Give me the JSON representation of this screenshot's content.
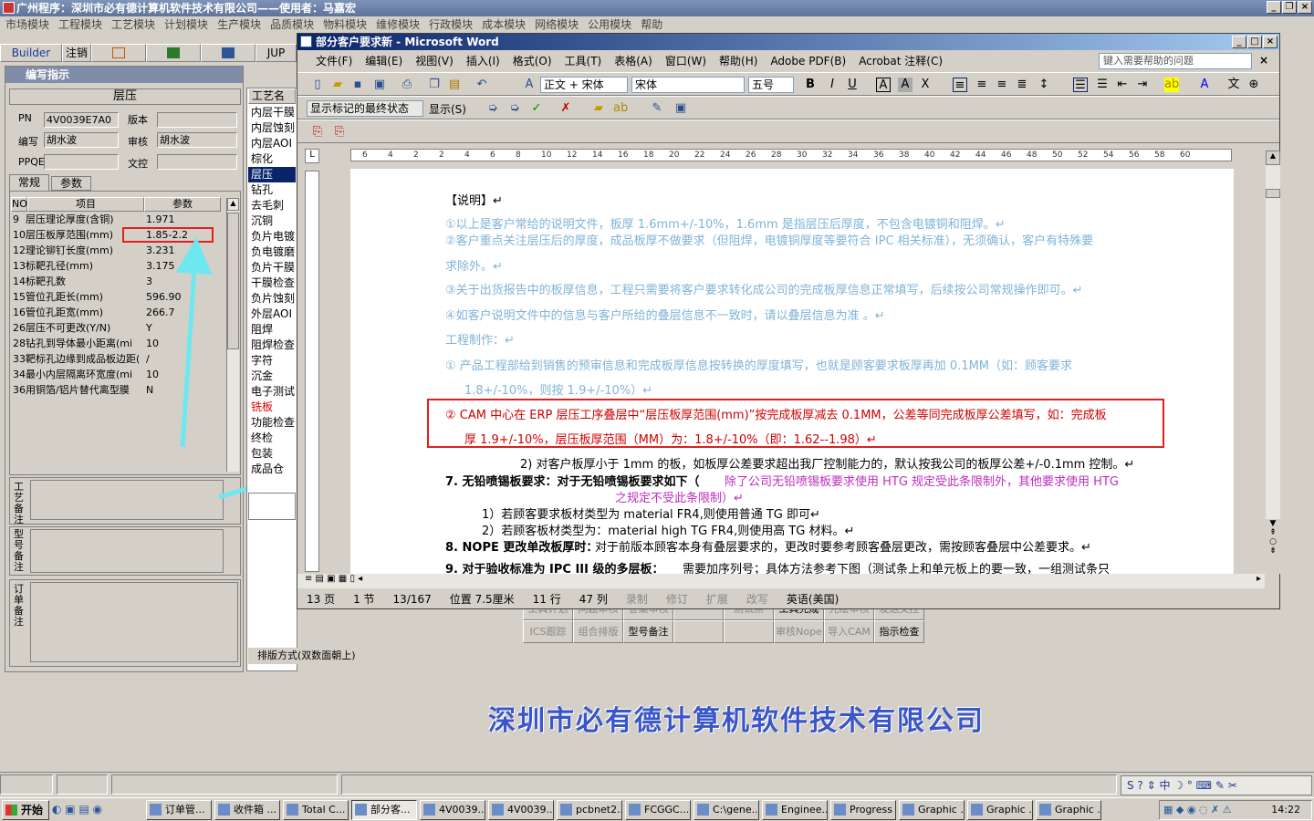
{
  "app": {
    "title": "广州程序：深圳市必有德计算机软件技术有限公司——使用者：马嘉宏",
    "menu": [
      "市场模块",
      "工程模块",
      "工艺模块",
      "计划模块",
      "生产模块",
      "品质模块",
      "物料模块",
      "维修模块",
      "行政模块",
      "成本模块",
      "网络模块",
      "公用模块",
      "帮助"
    ],
    "toolbar": [
      "Builder",
      "注销",
      "",
      "",
      "",
      "JUP"
    ],
    "panel_title": "编写指示",
    "section": "层压",
    "fields": {
      "pn_label": "PN",
      "pn_value": "4V0039E7A0",
      "version_label": "版本",
      "writer_label": "编写",
      "writer_value": "胡水波",
      "reviewer_label": "审核",
      "reviewer_value": "胡水波",
      "ppqe_label": "PPQE",
      "doc_label": "文控"
    },
    "tabs": [
      "常规",
      "参数"
    ],
    "table_headers": [
      "NO",
      "项目",
      "参数"
    ],
    "table_rows": [
      [
        "9",
        "层压理论厚度(含铜)",
        "1.971"
      ],
      [
        "10",
        "层压板厚范围(mm)",
        "1.85-2.2"
      ],
      [
        "12",
        "理论铆钉长度(mm)",
        "3.231"
      ],
      [
        "13",
        "标靶孔径(mm)",
        "3.175"
      ],
      [
        "14",
        "标靶孔数",
        "3"
      ],
      [
        "15",
        "管位孔距长(mm)",
        "596.90"
      ],
      [
        "16",
        "管位孔距宽(mm)",
        "266.7"
      ],
      [
        "26",
        "层压不可更改(Y/N)",
        "Y"
      ],
      [
        "28",
        "钻孔到导体最小距离(mi",
        "10"
      ],
      [
        "33",
        "靶标孔边缘到成品板边距(",
        "/"
      ],
      [
        "34",
        "最小内层隔离环宽度(mi",
        "10"
      ],
      [
        "36",
        "用铜箔/铝片替代离型膜",
        "N"
      ]
    ],
    "side_notes": [
      "工艺备注",
      "型号备注",
      "订单备注"
    ],
    "craft_header": "工艺名",
    "craft_items": [
      "内层干膜",
      "内层蚀刻",
      "内层AOI",
      "棕化",
      "层压",
      "钻孔",
      "去毛刺",
      "沉铜",
      "负片电镀",
      "负电镀磨",
      "负片干膜",
      "干膜检查",
      "负片蚀刻",
      "外层AOI",
      "阻焊",
      "阻焊检查",
      "字符",
      "沉金",
      "电子测试",
      "铣板",
      "功能检查",
      "终检",
      "包装",
      "成品仓"
    ],
    "layout_label": "排版方式(双数面朝上)",
    "bottom_grid": [
      [
        "工具计划",
        "问题审核",
        "答案审核",
        "",
        "测试点",
        "工具完成",
        "光绘审核",
        "发送文控"
      ],
      [
        "ICS跟踪",
        "组合排版",
        "型号备注",
        "",
        "",
        "审核Nope",
        "导入CAM",
        "指示检查"
      ]
    ],
    "company_banner": "深圳市必有德计算机软件技术有限公司"
  },
  "word": {
    "title": "部分客户要求新 - Microsoft Word",
    "menu": [
      "文件(F)",
      "编辑(E)",
      "视图(V)",
      "插入(I)",
      "格式(O)",
      "工具(T)",
      "表格(A)",
      "窗口(W)",
      "帮助(H)",
      "Adobe PDF(B)",
      "Acrobat 注释(C)"
    ],
    "help_placeholder": "键入需要帮助的问题",
    "style": "正文 + 宋体",
    "font": "宋体",
    "size": "五号",
    "markup_mode": "显示标记的最终状态",
    "show_label": "显示(S)",
    "ruler_ticks": [
      "6",
      "4",
      "2",
      "2",
      "4",
      "6",
      "8",
      "10",
      "12",
      "14",
      "16",
      "18",
      "20",
      "22",
      "24",
      "26",
      "28",
      "30",
      "32",
      "34",
      "36",
      "38",
      "40",
      "42",
      "44",
      "46",
      "48",
      "50",
      "52",
      "54",
      "56",
      "58",
      "60"
    ],
    "doc": {
      "heading": "【说明】↵",
      "note1": "①以上是客户常给的说明文件，板厚 1.6mm+/-10%，1.6mm 是指层压后厚度，不包含电镀铜和阻焊。↵",
      "note2a": "②客户重点关注层压后的厚度，成品板厚不做要求（但阻焊，电镀铜厚度等要符合 IPC 相关标准），无须确认，客户有特殊要",
      "note2b": "求除外。↵",
      "note3": "③关于出货报告中的板厚信息，工程只需要将客户要求转化成公司的完成板厚信息正常填写，后续按公司常规操作即可。↵",
      "note4": "④如客户说明文件中的信息与客户所给的叠层信息不一致时，请以叠层信息为准 。↵",
      "process": "工程制作：↵",
      "p1a": "①  产品工程部给到销售的预审信息和完成板厚信息按转换的厚度填写，也就是顾客要求板厚再加 0.1MM（如：顾客要求",
      "p1b": "1.8+/-10%，则按 1.9+/-10%）↵",
      "p2a": "②  CAM 中心在 ERP 层压工序叠层中“层压板厚范围(mm)”按完成板厚减去 0.1MM，公差等同完成板厚公差填写，如：完成板",
      "p2b": "厚 1.9+/-10%，层压板厚范围（MM）为：1.8+/-10%（即：1.62--1.98）↵",
      "l2": "2) 对客户板厚小于 1mm 的板，如板厚公差要求超出我厂控制能力的，默认按我公司的板厚公差+/-0.1mm 控制。↵",
      "l7a": "7.   无铅喷锡板要求：对于无铅喷锡板要求如下（",
      "l7b": "除了公司无铅喷锡板要求使用 HTG 规定受此条限制外，其他要求使用 HTG",
      "l7c": "之规定不受此条限制）↵",
      "l7_1": "1）若顾客要求板材类型为 material FR4,则使用普通 TG 即可↵",
      "l7_2": "2）若顾客板材类型为：material high TG FR4,则使用高 TG 材料。↵",
      "l8a": "8.  NOPE 更改单改板厚时：",
      "l8b": "对于前版本顾客本身有叠层要求的，更改时要参考顾客叠层更改，需按顾客叠层中公差要求。↵",
      "l9a": "9.  对于验收标准为 IPC III 级的多层板：",
      "l9b": "需要加序列号；具体方法参考下图（测试条上和单元板上的要一致，一组测试条只"
    },
    "status": [
      "13 页",
      "1 节",
      "13/167",
      "位置 7.5厘米",
      "11 行",
      "47 列",
      "录制",
      "修订",
      "扩展",
      "改写",
      "英语(美国)"
    ]
  },
  "taskbar": {
    "start": "开始",
    "items": [
      "订单管...",
      "收件箱 ...",
      "Total C...",
      "部分客...",
      "4V0039...",
      "4V0039...",
      "pcbnet2...",
      "FCGGC...",
      "C:\\gene...",
      "Enginee...",
      "Progress",
      "Graphic ...",
      "Graphic ...",
      "Graphic ..."
    ],
    "clock": "14:22"
  }
}
